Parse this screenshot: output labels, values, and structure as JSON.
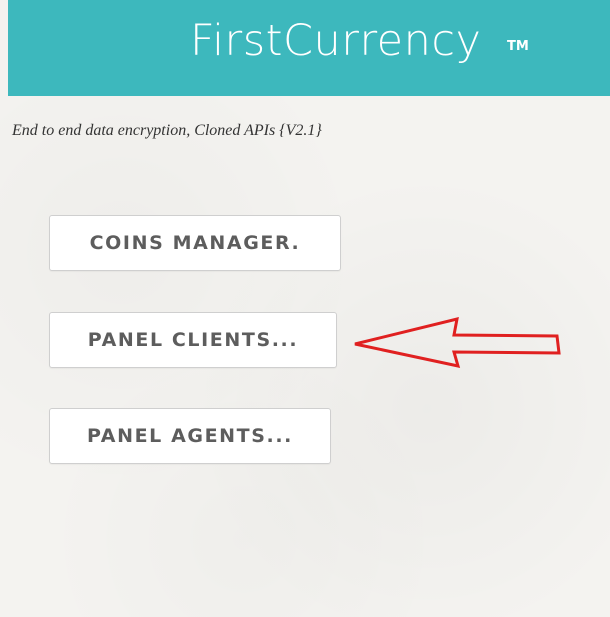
{
  "header": {
    "brand": "FirstCurrency",
    "trademark": "TM",
    "background_color": "#3db8bd"
  },
  "tagline": "End to end data encryption, Cloned APIs {V2.1}",
  "menu": {
    "coins_manager": "COINS MANAGER.",
    "panel_clients": "PANEL CLIENTS...",
    "panel_agents": "PANEL AGENTS..."
  },
  "annotation": {
    "arrow_color": "#e02020",
    "arrow_points_to": "panel_clients"
  }
}
